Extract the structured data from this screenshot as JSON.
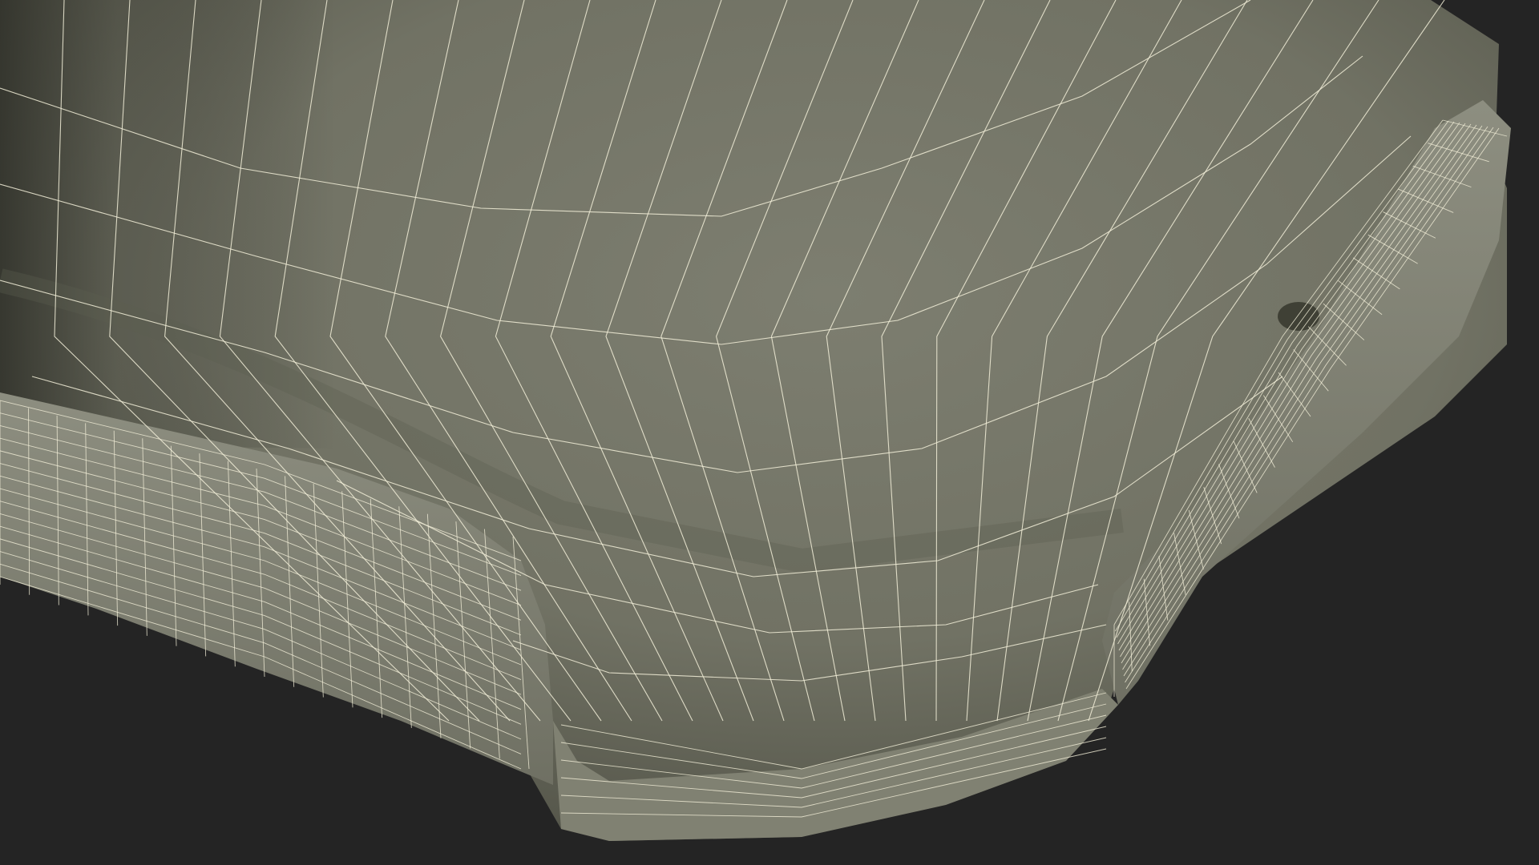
{
  "scene": {
    "subject": "wireframe-render",
    "colors": {
      "background": "#242424",
      "surface": "#777869",
      "surface_shadow": "#3e4035",
      "rim": "#8a8b7c",
      "wire": "#f2efd8"
    }
  }
}
